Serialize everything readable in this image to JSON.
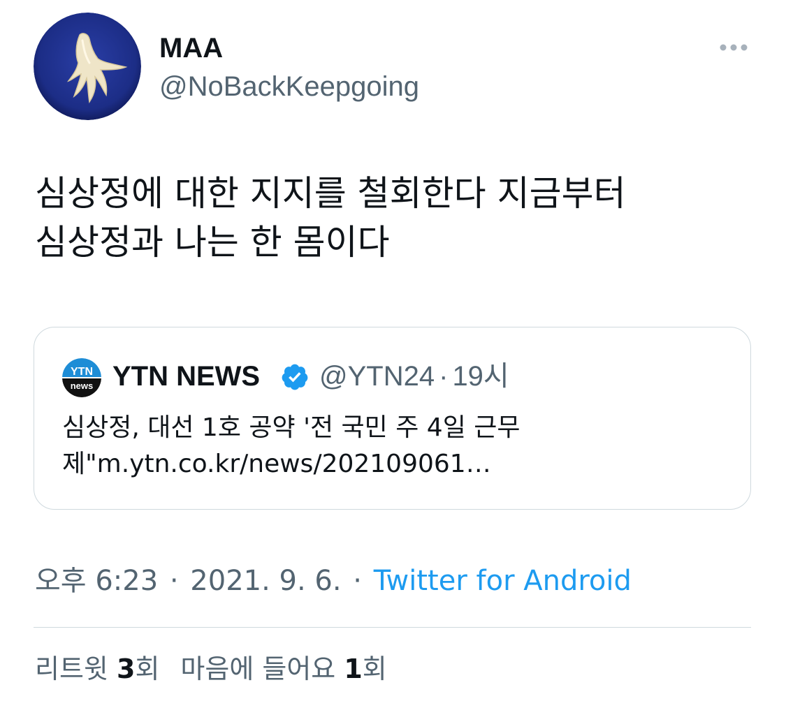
{
  "author": {
    "display_name": "MAA",
    "handle": "@NoBackKeepgoing",
    "avatar_icon": "bird-claw-sculpture-icon"
  },
  "more_icon": "more-horizontal-icon",
  "tweet": {
    "text_lines": [
      "심상정에 대한 지지를 철회한다 지금부터",
      "심상정과 나는 한 몸이다"
    ]
  },
  "quoted": {
    "logo_icon": "ytn-news-logo",
    "logo_text_top": "YTN",
    "logo_text_bottom": "news",
    "name": "YTN NEWS",
    "verified_icon": "verified-badge-icon",
    "handle": "@YTN24",
    "separator": "·",
    "time": "19시",
    "text_lines": [
      "심상정, 대선 1호 공약 '전 국민 주 4일 근무",
      "제\"m.ytn.co.kr/news/202109061…"
    ]
  },
  "meta": {
    "time": "오후 6:23",
    "separator": "·",
    "date": "2021. 9. 6.",
    "source": "Twitter for Android"
  },
  "stats": {
    "retweets_label": "리트윗",
    "retweets_count": "3",
    "retweets_suffix": "회",
    "likes_label": "마음에 들어요",
    "likes_count": "1",
    "likes_suffix": "회"
  },
  "colors": {
    "text_primary": "#0f1419",
    "text_secondary": "#536471",
    "link": "#1d9bf0",
    "border": "#cfd9de",
    "avatar_bg": "#1c2d86",
    "ytn_blue": "#1e8dd6"
  }
}
